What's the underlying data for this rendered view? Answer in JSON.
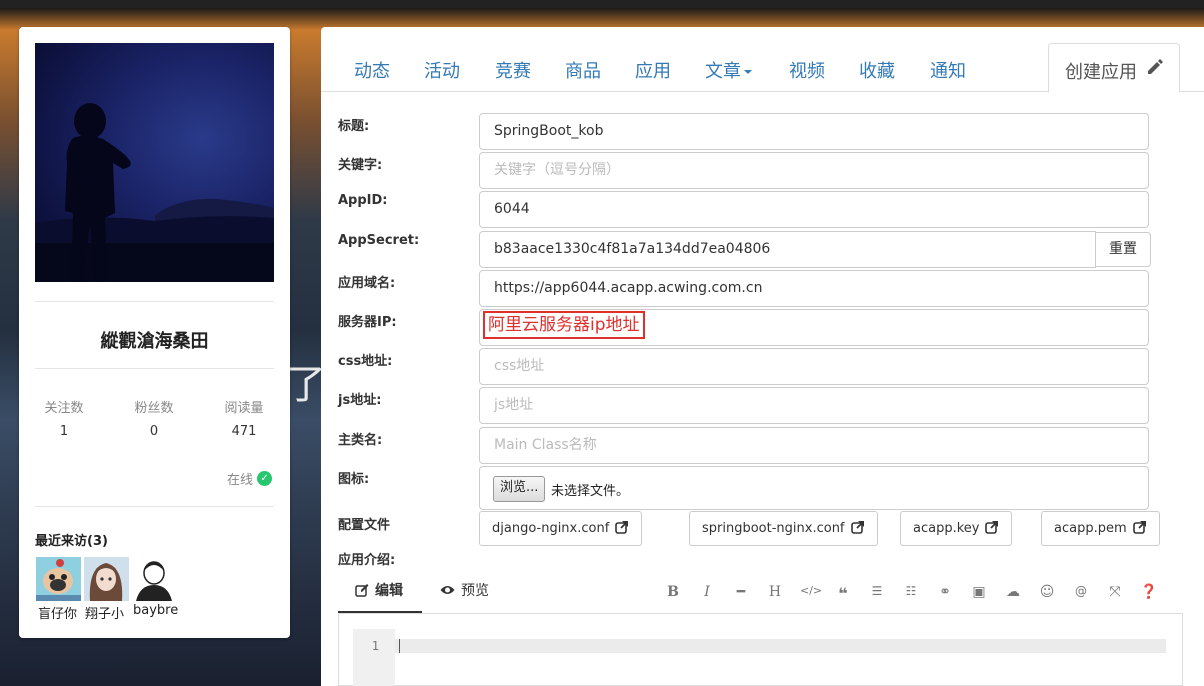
{
  "background_text": "了",
  "profile": {
    "username": "縱觀滄海桑田",
    "stats": [
      {
        "label": "关注数",
        "value": "1"
      },
      {
        "label": "粉丝数",
        "value": "0"
      },
      {
        "label": "阅读量",
        "value": "471"
      }
    ],
    "online_label": "在线",
    "recent_title": "最近来访(3)",
    "visitors": [
      {
        "name": "盲仔你"
      },
      {
        "name": "翔子小"
      },
      {
        "name": "baybre"
      }
    ]
  },
  "nav": {
    "tabs": [
      "动态",
      "活动",
      "竞赛",
      "商品",
      "应用",
      "文章",
      "视频",
      "收藏",
      "通知"
    ],
    "active_tab": "创建应用"
  },
  "form": {
    "fields": [
      {
        "label": "标题:",
        "value": "SpringBoot_kob",
        "placeholder": ""
      },
      {
        "label": "关键字:",
        "value": "",
        "placeholder": "关键字（逗号分隔）"
      },
      {
        "label": "AppID:",
        "value": "6044",
        "placeholder": ""
      },
      {
        "label": "AppSecret:",
        "value": "b83aace1330c4f81a7a134dd7ea04806",
        "placeholder": ""
      },
      {
        "label": "应用域名:",
        "value": "https://app6044.acapp.acwing.com.cn",
        "placeholder": ""
      },
      {
        "label": "服务器IP:",
        "value": "",
        "placeholder": ""
      },
      {
        "label": "css地址:",
        "value": "",
        "placeholder": "css地址"
      },
      {
        "label": "js地址:",
        "value": "",
        "placeholder": "js地址"
      },
      {
        "label": "主类名:",
        "value": "",
        "placeholder": "Main Class名称"
      },
      {
        "label": "图标:",
        "value": "",
        "placeholder": ""
      }
    ],
    "reset_label": "重置",
    "ip_annotation": "阿里云服务器ip地址",
    "file_button": "浏览...",
    "file_status": "未选择文件。",
    "config_label": "配置文件",
    "config_files": [
      "django-nginx.conf",
      "springboot-nginx.conf",
      "acapp.key",
      "acapp.pem"
    ],
    "intro_label": "应用介绍:"
  },
  "editor": {
    "tab_edit": "编辑",
    "tab_preview": "预览",
    "toolbar": [
      "bold-icon",
      "italic-icon",
      "hr-icon",
      "heading-icon",
      "code-icon",
      "quote-icon",
      "ul-icon",
      "ol-icon",
      "link-icon",
      "image-icon",
      "upload-icon",
      "emoji-icon",
      "mention-icon",
      "fullscreen-icon",
      "help-icon"
    ],
    "line_number": "1"
  },
  "colors": {
    "link": "#337ab7",
    "annotation": "#e0302e",
    "online": "#28c76f"
  }
}
